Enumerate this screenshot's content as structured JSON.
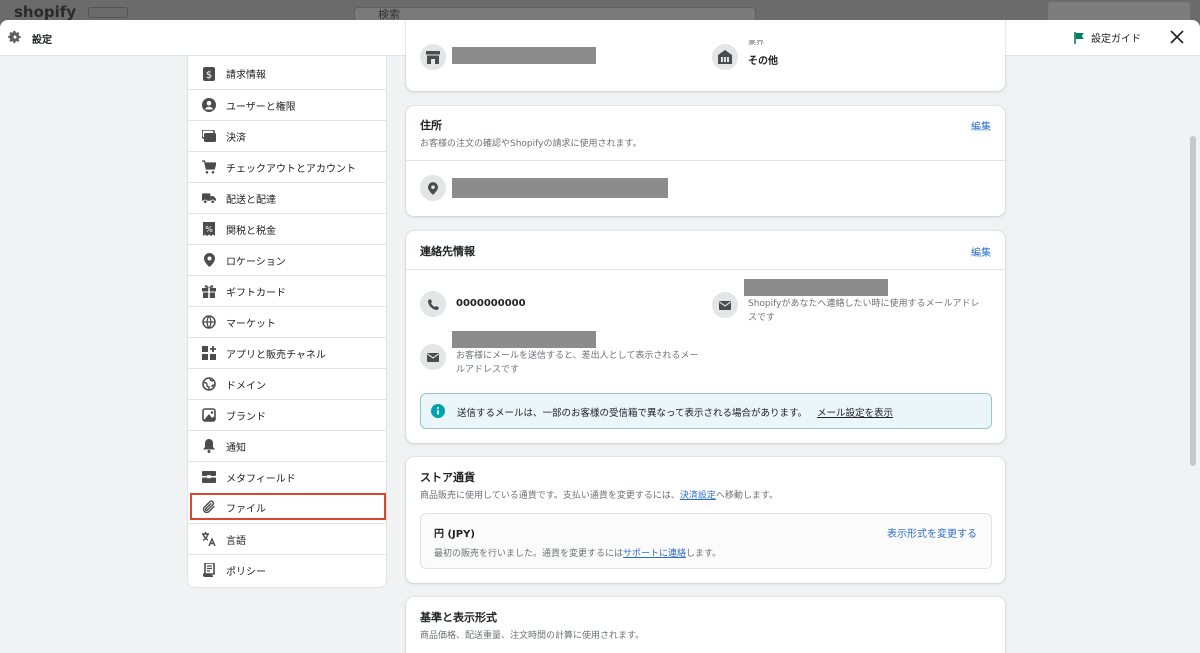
{
  "background": {
    "logo": "shopify",
    "search_placeholder": "検索"
  },
  "topbar": {
    "title": "設定",
    "guide_label": "設定ガイド"
  },
  "sidebar": {
    "items": [
      {
        "label": "請求情報",
        "icon": "billing-icon"
      },
      {
        "label": "ユーザーと権限",
        "icon": "user-icon"
      },
      {
        "label": "決済",
        "icon": "payment-icon"
      },
      {
        "label": "チェックアウトとアカウント",
        "icon": "cart-icon"
      },
      {
        "label": "配送と配達",
        "icon": "truck-icon"
      },
      {
        "label": "関税と税金",
        "icon": "tax-icon"
      },
      {
        "label": "ロケーション",
        "icon": "location-icon"
      },
      {
        "label": "ギフトカード",
        "icon": "gift-icon"
      },
      {
        "label": "マーケット",
        "icon": "globe-icon"
      },
      {
        "label": "アプリと販売チャネル",
        "icon": "apps-icon"
      },
      {
        "label": "ドメイン",
        "icon": "domain-icon"
      },
      {
        "label": "ブランド",
        "icon": "brand-icon"
      },
      {
        "label": "通知",
        "icon": "bell-icon"
      },
      {
        "label": "メタフィールド",
        "icon": "metafield-icon"
      },
      {
        "label": "ファイル",
        "icon": "paperclip-icon"
      },
      {
        "label": "言語",
        "icon": "language-icon"
      },
      {
        "label": "ポリシー",
        "icon": "policy-icon"
      }
    ]
  },
  "store_card": {
    "industry_label": "業界",
    "industry_value": "その他"
  },
  "address_card": {
    "title": "住所",
    "subtitle": "お客様の注文の確認やShopifyの請求に使用されます。",
    "edit": "編集"
  },
  "contact_card": {
    "title": "連絡先情報",
    "edit": "編集",
    "phone": "0000000000",
    "shopify_email_note": "Shopifyがあなたへ連絡したい時に使用するメールアドレスです",
    "sender_email_note": "お客様にメールを送信すると、差出人として表示されるメールアドレスです",
    "banner_text": "送信するメールは、一部のお客様の受信箱で異なって表示される場合があります。",
    "banner_link": "メール設定を表示"
  },
  "currency_card": {
    "title": "ストア通貨",
    "subtitle_pre": "商品販売に使用している通貨です。支払い通貨を変更するには、",
    "subtitle_link": "決済設定",
    "subtitle_post": "へ移動します。",
    "currency": "円 (JPY)",
    "change_format": "表示形式を変更する",
    "note_pre": "最初の販売を行いました。通貨を変更するには",
    "note_link": "サポートに連絡",
    "note_post": "します。"
  },
  "standards_card": {
    "title": "基準と表示形式",
    "subtitle": "商品価格、配送重量、注文時間の計算に使用されます。"
  }
}
